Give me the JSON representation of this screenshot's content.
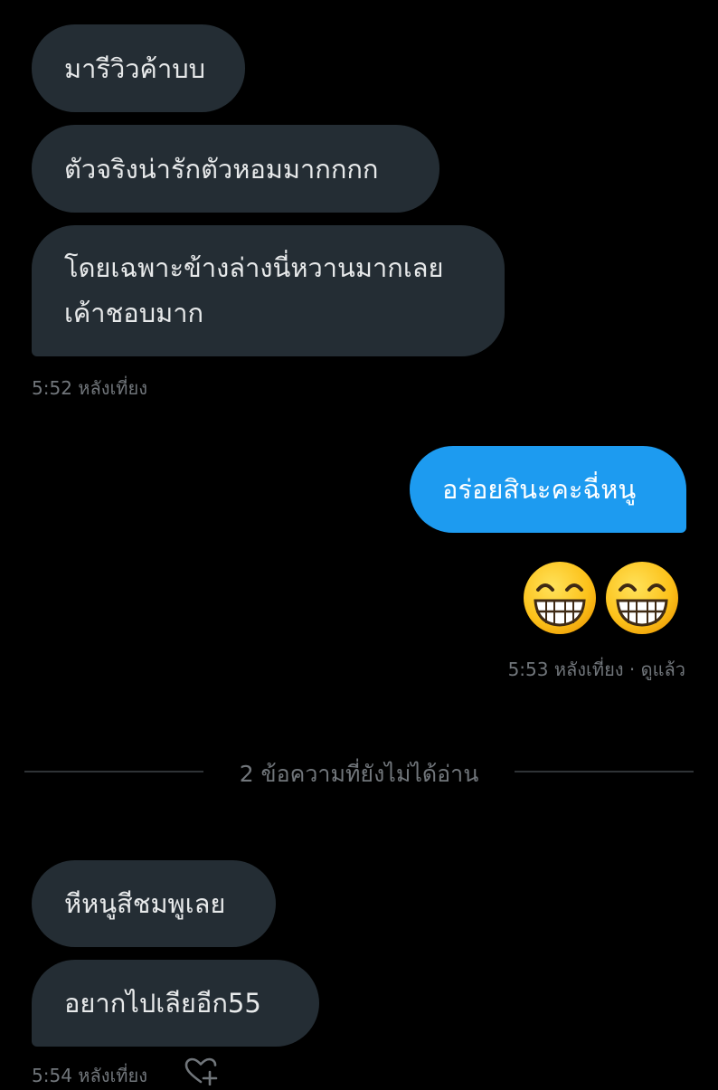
{
  "messages_received_1": [
    {
      "lines": [
        "มารีวิวค้าบบ"
      ]
    },
    {
      "lines": [
        "ตัวจริงน่ารักตัวหอมมากกกก"
      ]
    },
    {
      "lines": [
        "โดยเฉพาะข้างล่างนี่หวานมากเลย",
        "เค้าชอบมาก"
      ]
    }
  ],
  "received_1_time": "5:52 หลังเที่ยง",
  "sent_message": "อร่อยสินะคะฉี่หนู",
  "sent_emoji": [
    "grinning-face-with-smiling-eyes",
    "grinning-face-with-smiling-eyes"
  ],
  "sent_status": "5:53 หลังเที่ยง · ดูแล้ว",
  "unread_divider": "2 ข้อความที่ยังไม่ได้อ่าน",
  "messages_received_2": [
    {
      "lines": [
        "หีหนูสีชมพูเลย"
      ]
    },
    {
      "lines": [
        "อยากไปเลียอีก55"
      ]
    }
  ],
  "received_2_time": "5:54 หลังเที่ยง",
  "colors": {
    "background": "#000000",
    "received_bubble": "#242d34",
    "sent_bubble": "#1d9bf0",
    "meta_text": "#71767b",
    "divider": "#2f3336"
  },
  "icons": {
    "react": "heart-plus-icon"
  }
}
